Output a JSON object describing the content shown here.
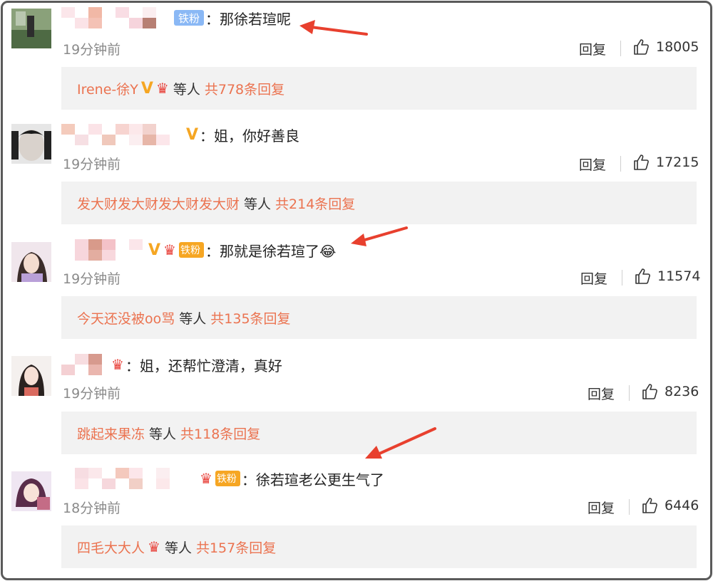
{
  "comments": [
    {
      "text": "：那徐若瑄呢",
      "badge": "铁粉",
      "time": "19分钟前",
      "reply_label": "回复",
      "likes": "18005",
      "replies": {
        "user": "Irene-徐Y",
        "mid": "等人",
        "count": "共778条回复"
      }
    },
    {
      "text": "：姐，你好善良",
      "time": "19分钟前",
      "reply_label": "回复",
      "likes": "17215",
      "replies": {
        "user": "发大财发大财发大财发大财",
        "mid": "等人",
        "count": "共214条回复"
      }
    },
    {
      "text": "：那就是徐若瑄了😂",
      "badge": "铁粉",
      "time": "19分钟前",
      "reply_label": "回复",
      "likes": "11574",
      "replies": {
        "user": "今天还没被oo骂",
        "mid": "等人",
        "count": "共135条回复"
      }
    },
    {
      "text": "：姐，还帮忙澄清，真好",
      "time": "19分钟前",
      "reply_label": "回复",
      "likes": "8236",
      "replies": {
        "user": "跳起来果冻",
        "mid": "等人",
        "count": "共118条回复"
      }
    },
    {
      "text": "：徐若瑄老公更生气了",
      "badge": "铁粉",
      "time": "18分钟前",
      "reply_label": "回复",
      "likes": "6446",
      "replies": {
        "user": "四毛大大人",
        "mid": "等人",
        "count": "共157条回复"
      }
    }
  ],
  "colors": {
    "link": "#eb7350",
    "arrow": "#e8402e",
    "reply_bg": "#f2f2f2"
  }
}
